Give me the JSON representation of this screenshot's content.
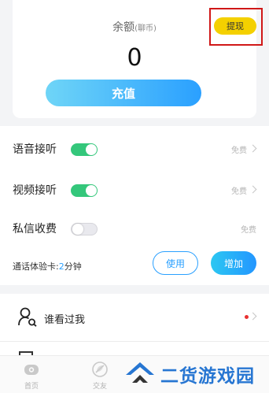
{
  "balance": {
    "label": "余额",
    "unit": "(聊币)",
    "value": "0",
    "recharge_label": "充值",
    "withdraw_label": "提现"
  },
  "settings": {
    "rows": [
      {
        "label": "语音接听",
        "toggle": "on",
        "value": "免费"
      },
      {
        "label": "视频接听",
        "toggle": "on",
        "value": "免费"
      },
      {
        "label": "私信收费",
        "toggle": "off",
        "value": "免费"
      }
    ],
    "trial": {
      "label": "通话体验卡:",
      "minutes": "2",
      "unit": "分钟"
    },
    "use_label": "使用",
    "add_label": "增加"
  },
  "visitors": {
    "label": "谁看过我",
    "has_badge": true
  },
  "bottom_nav": {
    "items": [
      {
        "label": "首页",
        "icon": "home-icon"
      },
      {
        "label": "交友",
        "icon": "leaf-icon"
      }
    ]
  },
  "watermark": {
    "text": "二货游戏园"
  },
  "colors": {
    "accent": "#2aa0ff",
    "toggle_on": "#34c77b",
    "withdraw": "#f4d000",
    "highlight_box": "#d01818",
    "badge": "#e83030"
  }
}
